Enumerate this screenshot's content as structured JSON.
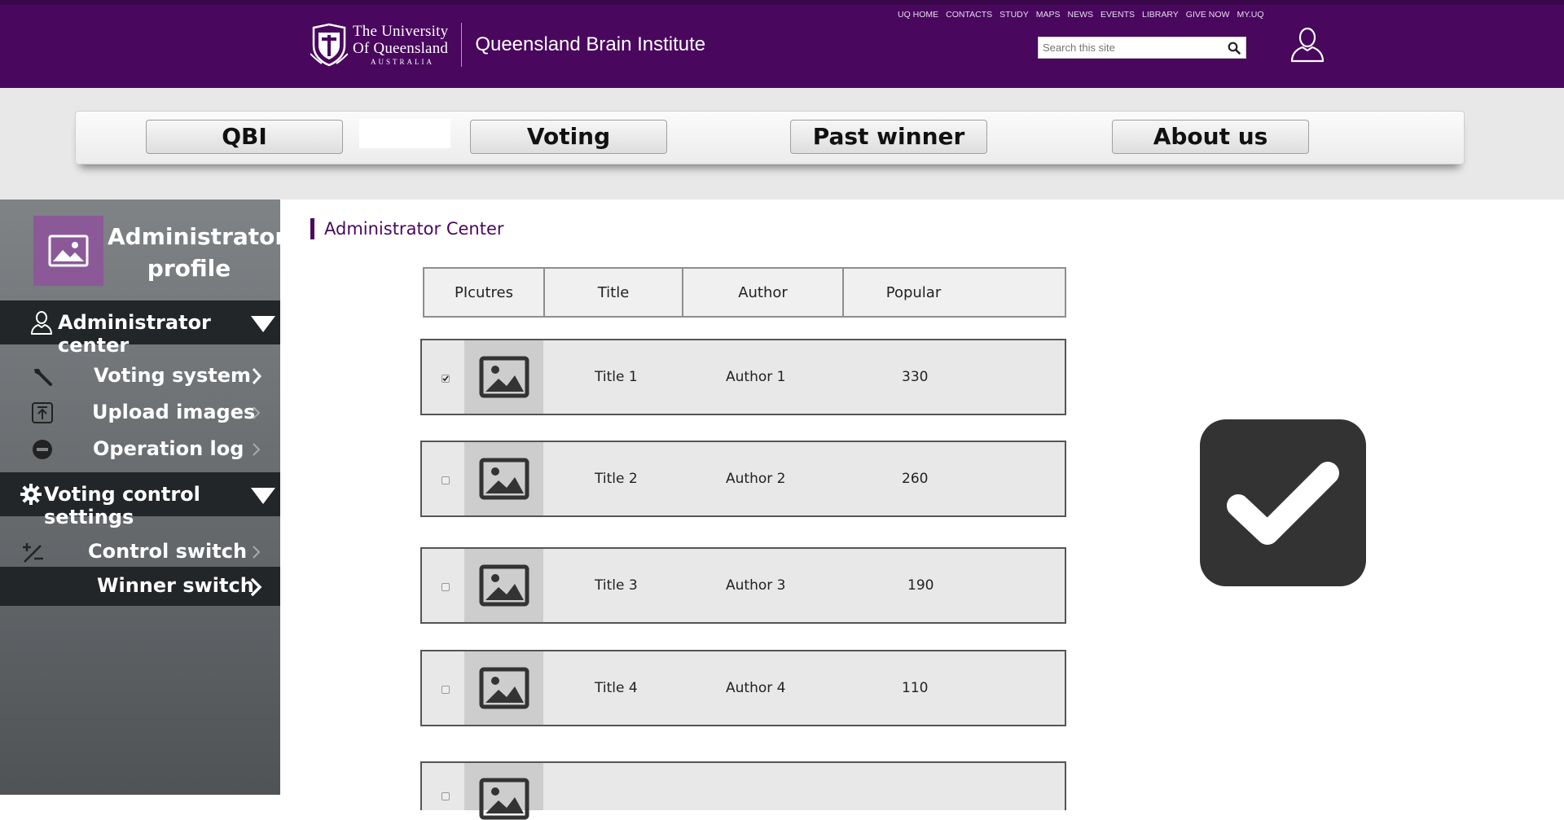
{
  "header": {
    "university_line1": "The University",
    "university_line2": "Of Queensland",
    "university_line3": "AUSTRALIA",
    "institute": "Queensland Brain Institute",
    "top_links": [
      "UQ HOME",
      "CONTACTS",
      "STUDY",
      "MAPS",
      "NEWS",
      "EVENTS",
      "LIBRARY",
      "GIVE NOW",
      "MY.UQ"
    ],
    "search_placeholder": "Search this site",
    "brand_color": "#49075e"
  },
  "nav": {
    "items": [
      "QBI",
      "Voting",
      "Past winner",
      "About us"
    ]
  },
  "sidebar": {
    "profile_name": "Administrator profile",
    "section1": "Administrator center",
    "items1": [
      "Voting system",
      "Upload images",
      "Operation log"
    ],
    "section2": "Voting control settings",
    "items2": [
      "Control switch",
      "Winner switch"
    ]
  },
  "main": {
    "title": "Administrator  Center",
    "columns": [
      "PIcutres",
      "Title",
      "Author",
      "Popular"
    ],
    "rows": [
      {
        "title": "Title 1",
        "author": "Author 1",
        "popular": "330",
        "checked": true
      },
      {
        "title": "Title 2",
        "author": "Author 2",
        "popular": "260",
        "checked": false
      },
      {
        "title": "Title 3",
        "author": "Author 3",
        "popular": "190",
        "checked": false
      },
      {
        "title": "Title 4",
        "author": "Author 4",
        "popular": "110",
        "checked": false
      }
    ]
  },
  "icons": {
    "search": "search-icon",
    "user": "user-icon",
    "image": "image-icon",
    "confirm": "checkmark-icon"
  }
}
